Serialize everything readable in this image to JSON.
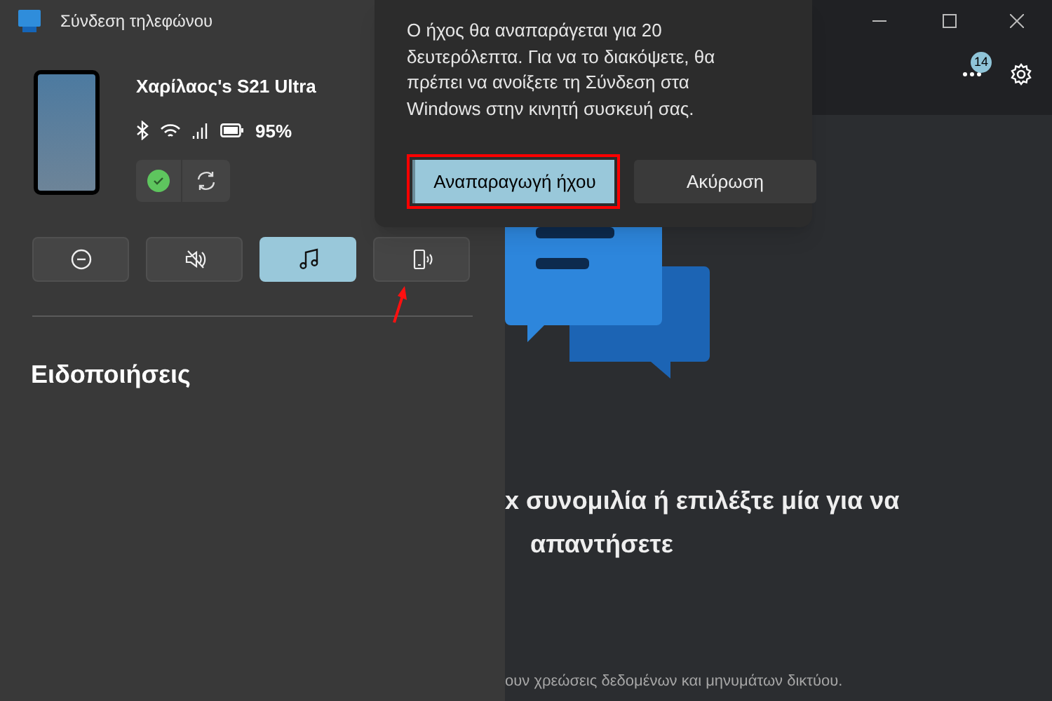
{
  "window": {
    "title": "Σύνδεση τηλεφώνου"
  },
  "device": {
    "name": "Χαρίλαος's S21 Ultra",
    "battery": "95%",
    "connected": true
  },
  "quick_actions": [
    {
      "kind": "dnd",
      "selected": false
    },
    {
      "kind": "mute",
      "selected": false
    },
    {
      "kind": "music",
      "selected": true
    },
    {
      "kind": "ring",
      "selected": false
    }
  ],
  "notifications": {
    "title": "Ειδοποιήσεις"
  },
  "header": {
    "badge": "14"
  },
  "dialog": {
    "message": "Ο ήχος θα αναπαράγεται για 20 δευτερόλεπτα. Για να το διακόψετε, θα πρέπει να ανοίξετε τη Σύνδεση στα Windows στην κινητή συσκευή σας.",
    "buttons": [
      {
        "label": "Αναπαραγωγή ήχου",
        "kind": "primary",
        "highlighted": true
      },
      {
        "label": "Ακύρωση",
        "kind": "secondary",
        "highlighted": false
      }
    ]
  },
  "messages": {
    "prompt_line_1": "x συνομιλία ή επιλέξτε μία για να",
    "prompt_line_2": "απαντήσετε",
    "footnote": "ουν χρεώσεις δεδομένων και μηνυμάτων δικτύου."
  }
}
